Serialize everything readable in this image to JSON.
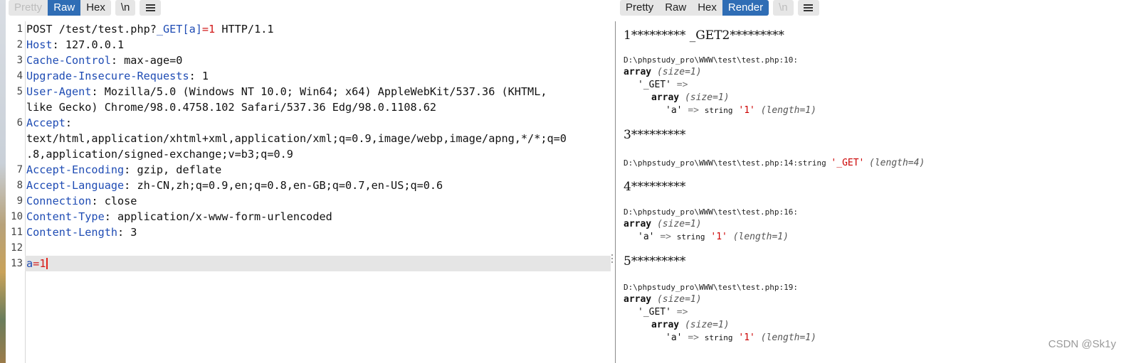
{
  "left_toolbar": {
    "tabs": [
      "Pretty",
      "Raw",
      "Hex"
    ],
    "active": "Raw",
    "newline": "\\n",
    "menu_icon": "hamburger-menu-icon"
  },
  "right_toolbar": {
    "tabs": [
      "Pretty",
      "Raw",
      "Hex",
      "Render"
    ],
    "active": "Render",
    "newline": "\\n",
    "menu_icon": "hamburger-menu-icon"
  },
  "request": {
    "l1_a": "POST /test/test.php?",
    "l1_b": "_GET[a]",
    "l1_c": "=",
    "l1_d": "1",
    "l1_e": " HTTP/1.1",
    "host_k": "Host",
    "host_v": ": 127.0.0.1",
    "cc_k": "Cache-Control",
    "cc_v": ": max-age=0",
    "uir_k": "Upgrade-Insecure-Requests",
    "uir_v": ": 1",
    "ua_k": "User-Agent",
    "ua_v1": ": Mozilla/5.0 (Windows NT 10.0; Win64; x64) AppleWebKit/537.36 (KHTML,",
    "ua_v2": "like Gecko) Chrome/98.0.4758.102 Safari/537.36 Edg/98.0.1108.62",
    "acc_k": "Accept",
    "acc_v0": ":",
    "acc_v1": "text/html,application/xhtml+xml,application/xml;q=0.9,image/webp,image/apng,*/*;q=0",
    "acc_v2": ".8,application/signed-exchange;v=b3;q=0.9",
    "ae_k": "Accept-Encoding",
    "ae_v": ": gzip, deflate",
    "al_k": "Accept-Language",
    "al_v": ": zh-CN,zh;q=0.9,en;q=0.8,en-GB;q=0.7,en-US;q=0.6",
    "conn_k": "Connection",
    "conn_v": ": close",
    "ct_k": "Content-Type",
    "ct_v": ": application/x-www-form-urlencoded",
    "cl_k": "Content-Length",
    "cl_v": ": 3",
    "body_k": "a",
    "body_eq": "=",
    "body_v": "1",
    "line_numbers": [
      "1",
      "2",
      "3",
      "4",
      "5",
      "6",
      "7",
      "8",
      "9",
      "10",
      "11",
      "12",
      "13"
    ]
  },
  "render": {
    "h1": "1********* _GET2*********",
    "p1": "D:\\phpstudy_pro\\WWW\\test\\test.php:10:",
    "array": "array",
    "size1": "(size=1)",
    "get_key": "'_GET'",
    "arrow": "=>",
    "a_key": "'a'",
    "string": "string",
    "one": "'1'",
    "len1": "(length=1)",
    "h3": "3*********",
    "p3": "D:\\phpstudy_pro\\WWW\\test\\test.php:14:",
    "get_str": "'_GET'",
    "len4": "(length=4)",
    "h4": "4*********",
    "p4": "D:\\phpstudy_pro\\WWW\\test\\test.php:16:",
    "h5": "5*********",
    "p5": "D:\\phpstudy_pro\\WWW\\test\\test.php:19:"
  },
  "watermark": "CSDN @Sk1y"
}
